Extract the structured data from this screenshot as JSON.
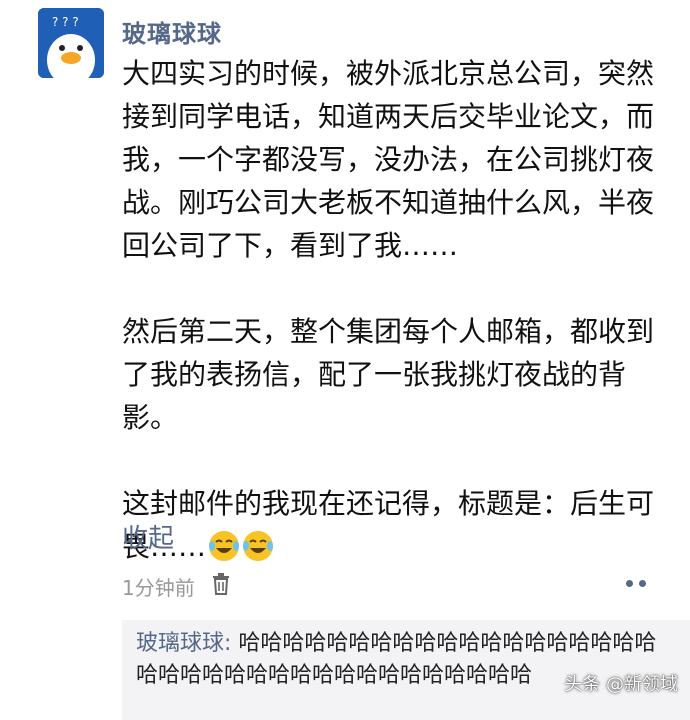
{
  "post": {
    "author": "玻璃球球",
    "paragraphs": [
      "大四实习的时候，被外派北京总公司，突然接到同学电话，知道两天后交毕业论文，而我，一个字都没写，没办法，在公司挑灯夜战。刚巧公司大老板不知道抽什么风，半夜回公司了下，看到了我……",
      "然后第二天，整个集团每个人邮箱，都收到了我的表扬信，配了一张我挑灯夜战的背影。",
      "这封邮件的我现在还记得，标题是：后生可畏……"
    ],
    "emoji_icons": [
      "laughing-tears-icon",
      "laughing-tears-icon"
    ],
    "collapse_label": "收起",
    "timestamp": "1分钟前"
  },
  "comment": {
    "author": "玻璃球球:",
    "text": "哈哈哈哈哈哈哈哈哈哈哈哈哈哈哈哈哈哈哈哈哈哈哈哈哈哈哈哈哈哈哈哈哈哈哈哈哈"
  },
  "watermark": "头条 @新领域",
  "colors": {
    "name_link": "#55688a",
    "avatar_bg": "#1f5fb5",
    "comment_bg": "#f3f3f5"
  }
}
